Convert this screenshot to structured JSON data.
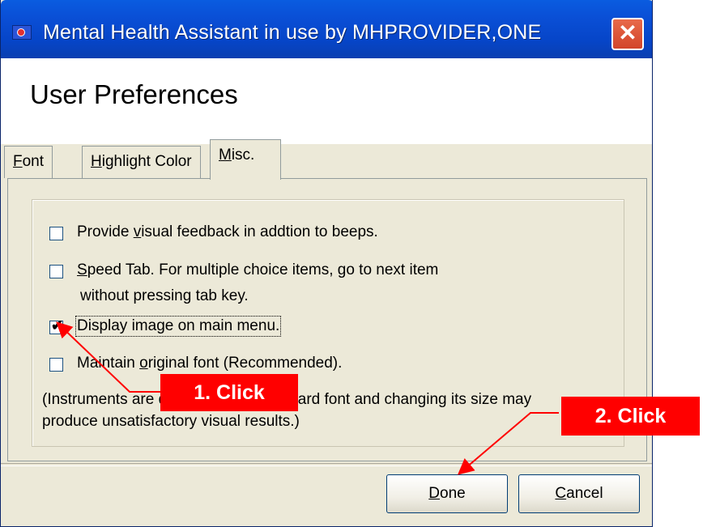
{
  "window": {
    "title": "Mental Health Assistant in use by MHPROVIDER,ONE",
    "close_glyph": "✕"
  },
  "header": {
    "title": "User Preferences"
  },
  "tabs": [
    {
      "label_prefix": "",
      "label_underline": "F",
      "label_rest": "ont",
      "active": false
    },
    {
      "label_prefix": "",
      "label_underline": "H",
      "label_rest": "ighlight Color",
      "active": false
    },
    {
      "label_prefix": "",
      "label_underline": "M",
      "label_rest": "isc.",
      "active": true
    }
  ],
  "options": [
    {
      "checked": false,
      "line1_pre": "Provide ",
      "line1_u": "v",
      "line1_post": "isual feedback in addtion to beeps."
    },
    {
      "checked": false,
      "line1_pre": "",
      "line1_u": "S",
      "line1_post": "peed Tab. For multiple choice items, go to next item",
      "line2": "without pressing tab key."
    },
    {
      "checked": true,
      "line1_pre": "",
      "line1_u": "",
      "line1_post": "Display image on main menu."
    },
    {
      "checked": false,
      "line1_pre": "Maintain ",
      "line1_u": "o",
      "line1_post": "riginal font (Recommended)."
    }
  ],
  "note": {
    "line1": "(Instruments are designed for a standard font and changing its size may",
    "line2": "produce unsatisfactory visual results.)"
  },
  "buttons": {
    "done": {
      "u": "D",
      "rest": "one"
    },
    "cancel": {
      "u": "C",
      "rest": "ancel"
    }
  },
  "annotations": {
    "step1": "1. Click",
    "step2": "2. Click",
    "color": "#ff0000"
  },
  "colors": {
    "titlebar": "#0a4fd6",
    "dialog_bg": "#ece9d8",
    "close_button": "#d2442a"
  }
}
